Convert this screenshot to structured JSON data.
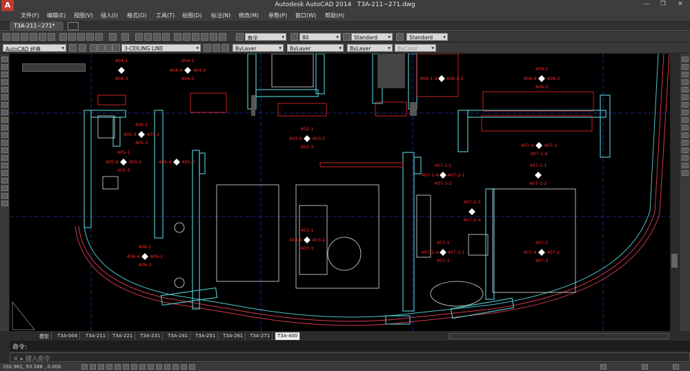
{
  "window": {
    "app_title": "Autodesk AutoCAD 2014",
    "file_title": "T3A-211~271.dwg",
    "logo_letter": "A",
    "minimize": "—",
    "restore": "❐",
    "close": "✕"
  },
  "menu": [
    "文件(F)",
    "编辑(E)",
    "视图(V)",
    "插入(I)",
    "格式(O)",
    "工具(T)",
    "绘图(D)",
    "标注(N)",
    "修改(M)",
    "参数(P)",
    "窗口(W)",
    "帮助(H)"
  ],
  "doc_tab": "T3A-211~271*",
  "toolbar1": {
    "text_style": "数字",
    "dim_value": "80",
    "dim_style": "Standard",
    "table_style": "Standard"
  },
  "toolbar2": {
    "workspace": "AutoCAD 经典",
    "layer": "3-CEILING LINE",
    "color": "ByLayer",
    "linetype": "ByLayer",
    "lineweight": "ByLayer",
    "plotstyle": "ByColor"
  },
  "layout_tabs": [
    "模型",
    "T3A-004",
    "T3A-211",
    "T3A-221",
    "T3A-231",
    "T3A-241",
    "T3A-251",
    "T3A-261",
    "T3A-271",
    "T3A-400"
  ],
  "active_layout": "T3A-400",
  "command_history": "命令:",
  "command_prompt": "键入命令",
  "status_coords": "292.961, 93.588 , 0.000",
  "colors": {
    "canvas": "#000000",
    "room_labels": "#ff2a2a",
    "walls": "#4fc3c8",
    "furniture": "#ffffff",
    "grid": "#2233aa"
  },
  "room_tags": [
    {
      "id": "t1",
      "top": "404-1",
      "left": "",
      "right": "",
      "bottom": "404-3"
    },
    {
      "id": "t2",
      "top": "404-1",
      "left": "404-4",
      "right": "404-2",
      "bottom": "404-3"
    },
    {
      "id": "t3",
      "top": "405-1",
      "left": "405-4",
      "right": "405-2",
      "bottom": "405-3"
    },
    {
      "id": "t4",
      "top": "405-1",
      "left": "405-4",
      "right": "405-2",
      "bottom": "405-3"
    },
    {
      "id": "t5",
      "top": "",
      "left": "405-4",
      "right": "405-2",
      "bottom": ""
    },
    {
      "id": "t6",
      "top": "406-1",
      "left": "406-4",
      "right": "406-2",
      "bottom": "406-3"
    },
    {
      "id": "t7",
      "top": "402-1",
      "left": "403-4",
      "right": "403-2",
      "bottom": "402-3"
    },
    {
      "id": "t8",
      "top": "403-1",
      "left": "403-4",
      "right": "403-2",
      "bottom": "403-3"
    },
    {
      "id": "t9",
      "top": "",
      "left": "408-1-4",
      "right": "408-1-2",
      "bottom": ""
    },
    {
      "id": "t10",
      "top": "409-1",
      "left": "409-4",
      "right": "409-2",
      "bottom": "409-3"
    },
    {
      "id": "t11",
      "top": "",
      "left": "407-4",
      "right": "407-2",
      "bottom": "407-1-4"
    },
    {
      "id": "t12",
      "top": "407-1-1",
      "left": "407-1-4",
      "right": "407-2-1",
      "bottom": "407-1-2"
    },
    {
      "id": "t13",
      "top": "407-1-1",
      "left": "",
      "right": "",
      "bottom": "407-1-2"
    },
    {
      "id": "t14",
      "top": "407-2-3",
      "left": "",
      "right": "",
      "bottom": "407-2-4"
    },
    {
      "id": "t15",
      "top": "407-1",
      "left": "407-2-4",
      "right": "407-2-1",
      "bottom": "407-3"
    },
    {
      "id": "t16",
      "top": "407-1",
      "left": "407-4",
      "right": "407-2",
      "bottom": "407-3"
    }
  ]
}
